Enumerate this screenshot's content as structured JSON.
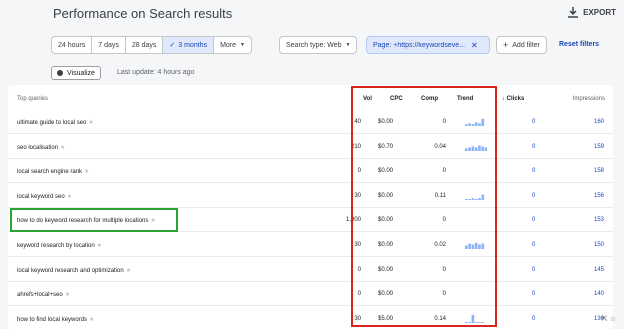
{
  "header": {
    "title": "Performance on Search results",
    "export_label": "EXPORT"
  },
  "ranges": [
    {
      "label": "24 hours",
      "active": false
    },
    {
      "label": "7 days",
      "active": false
    },
    {
      "label": "28 days",
      "active": false
    },
    {
      "label": "3 months",
      "active": true
    },
    {
      "label": "More",
      "active": false
    }
  ],
  "filters": {
    "search_type": "Search type: Web",
    "page": "Page: +https://keywordseve...",
    "add": "Add filter",
    "reset": "Reset filters"
  },
  "visualize_label": "Visualize",
  "last_update": "Last update: 4 hours ago",
  "columns": {
    "query": "Top queries",
    "vol": "Vol",
    "cpc": "CPC",
    "comp": "Comp",
    "trend": "Trend",
    "clicks": "Clicks",
    "impressions": "Impressions"
  },
  "rows": [
    {
      "query": "ultimate guide to local seo",
      "vol": "40",
      "cpc": "$0.00",
      "comp": "0",
      "trend": [
        0.2,
        0.3,
        0.2,
        0.4,
        0.3,
        0.8
      ],
      "clicks": "0",
      "impressions": "160"
    },
    {
      "query": "seo localisation",
      "vol": "210",
      "cpc": "$0.70",
      "comp": "0.04",
      "trend": [
        0.3,
        0.4,
        0.5,
        0.4,
        0.6,
        0.5,
        0.4
      ],
      "clicks": "0",
      "impressions": "159"
    },
    {
      "query": "local search engine rank",
      "vol": "0",
      "cpc": "$0.00",
      "comp": "0",
      "trend": [],
      "clicks": "0",
      "impressions": "158"
    },
    {
      "query": "local keyword seo",
      "vol": "30",
      "cpc": "$0.00",
      "comp": "0.11",
      "trend": [
        0.1,
        0.1,
        0.2,
        0.1,
        0.2,
        0.6
      ],
      "clicks": "0",
      "impressions": "156"
    },
    {
      "query": "how to do keyword research for multiple locations",
      "vol": "1,900",
      "cpc": "$0.00",
      "comp": "0",
      "trend": [],
      "clicks": "0",
      "impressions": "153"
    },
    {
      "query": "keyword research by location",
      "vol": "30",
      "cpc": "$0.00",
      "comp": "0.02",
      "trend": [
        0.4,
        0.6,
        0.5,
        0.7,
        0.5,
        0.6
      ],
      "clicks": "0",
      "impressions": "150"
    },
    {
      "query": "local keyword research and optimization",
      "vol": "0",
      "cpc": "$0.00",
      "comp": "0",
      "trend": [],
      "clicks": "0",
      "impressions": "145"
    },
    {
      "query": "ahrefs+local+seo",
      "vol": "0",
      "cpc": "$0.00",
      "comp": "0",
      "trend": [],
      "clicks": "0",
      "impressions": "140"
    },
    {
      "query": "how to find local keywords",
      "vol": "30",
      "cpc": "$5.00",
      "comp": "0.14",
      "trend": [
        0.1,
        0.1,
        0.9,
        0.1,
        0.1,
        0.1
      ],
      "clicks": "0",
      "impressions": "136"
    }
  ],
  "colors": {
    "accent": "#1a47b8",
    "trend": "#8ab4f8",
    "highlight_red": "#d9241f",
    "highlight_green": "#2aa234"
  }
}
